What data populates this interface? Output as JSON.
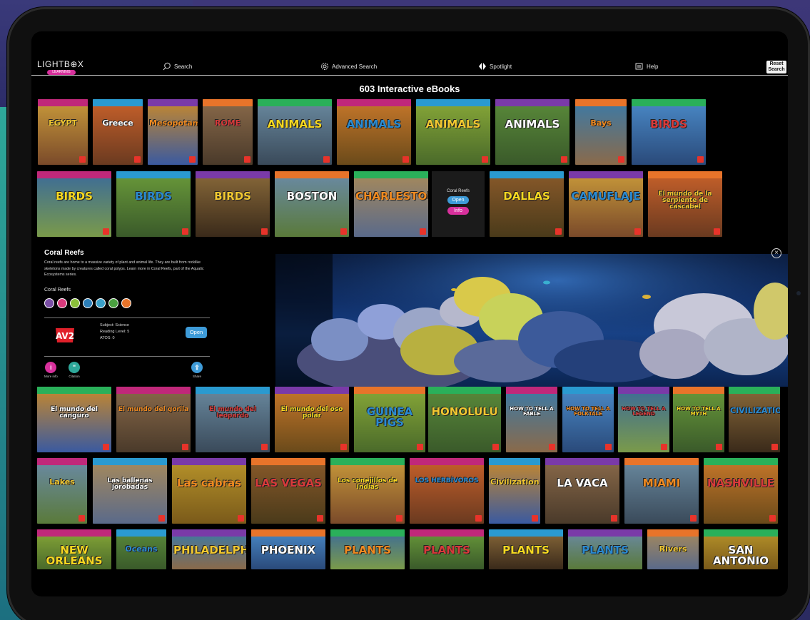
{
  "logo": {
    "text": "LIGHTB⊕X",
    "badge": "LEARNING"
  },
  "nav": {
    "search": "Search",
    "advanced": "Advanced Search",
    "spotlight": "Spotlight",
    "help": "Help",
    "reset_line1": "Reset",
    "reset_line2": "Search"
  },
  "page_title": "603 Interactive eBooks",
  "rows": [
    [
      "EGYPT",
      "Greece",
      "Mesopotamia",
      "ROME",
      "ANIMALS",
      "ANIMALS",
      "ANIMALS",
      "ANIMALS",
      "Bays",
      "BIRDS"
    ],
    [
      "BIRDS",
      "BIRDS",
      "BIRDS",
      "BOSTON",
      "CHARLESTON",
      "",
      "DALLAS",
      "CAMUFLAJE",
      "El mundo de la serpiente de cascabel"
    ],
    [
      "El mundo del canguro",
      "El mundo del gorila",
      "El mundo del leopardo",
      "El mundo del oso polar",
      "GUINEA PIGS",
      "HONOLULU",
      "HOW TO TELL A FABLE",
      "HOW TO TELL A FOLKTALE",
      "HOW TO TELL A LEGEND",
      "HOW TO TELL A MYTH",
      "CIVILIZATION"
    ],
    [
      "Lakes",
      "Las ballenas jorobadas",
      "Las cabras",
      "LAS VEGAS",
      "Los conejillos de Indias",
      "LOS HERBÍVOROS",
      "Civilization",
      "LA VACA",
      "MIAMI",
      "NASHVILLE"
    ],
    [
      "NEW ORLEANS",
      "Oceans",
      "PHILADELPHIA",
      "PHOENIX",
      "PLANTS",
      "PLANTS",
      "PLANTS",
      "PLANTS",
      "Rivers",
      "SAN ANTONIO"
    ]
  ],
  "spotlight_tile": {
    "name": "Coral Reefs",
    "open": "Open",
    "info": "Info"
  },
  "detail": {
    "title": "Coral Reefs",
    "description": "Coral reefs are home to a massive variety of plant and animal life. They are built from rocklike skeletons made by creatures called coral polyps. Learn more in Coral Reefs, part of the Aquatic Ecosystems series.",
    "series": "Coral Reefs",
    "subject": "Subject:  Science",
    "reading": "Reading Level:  5",
    "atos": "ATOS:  0",
    "open": "Open",
    "more_info": "More info",
    "citation": "Citation",
    "share": "Share",
    "logo": "AV2"
  },
  "colors": {
    "accent_blue": "#3e9bd8",
    "accent_pink": "#d8309c",
    "icon_colors": [
      "#7b4fa6",
      "#d93a7c",
      "#8bbf3a",
      "#2c7fb8",
      "#3aa0c8",
      "#4aa040",
      "#e8742a"
    ]
  }
}
